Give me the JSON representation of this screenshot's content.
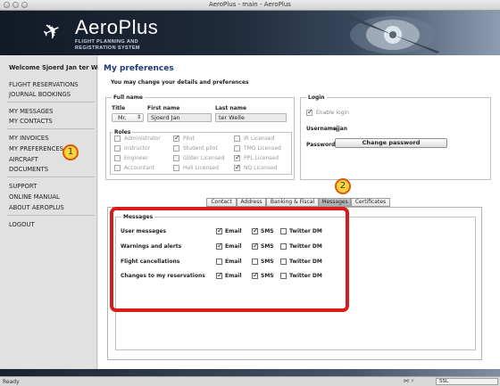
{
  "window": {
    "title": "AeroPlus - main - AeroPlus"
  },
  "brand": {
    "name": "AeroPlus",
    "tagline_1": "FLIGHT PLANNING AND",
    "tagline_2": "REGISTRATION SYSTEM"
  },
  "sidebar": {
    "welcome": "Welcome Sjoerd Jan ter Welle",
    "items": [
      {
        "label": "FLIGHT RESERVATIONS"
      },
      {
        "label": "JOURNAL BOOKINGS"
      },
      {
        "label": "MY MESSAGES"
      },
      {
        "label": "MY CONTACTS"
      },
      {
        "label": "MY INVOICES"
      },
      {
        "label": "MY PREFERENCES"
      },
      {
        "label": "AIRCRAFT"
      },
      {
        "label": "DOCUMENTS"
      },
      {
        "label": "SUPPORT"
      },
      {
        "label": "ONLINE MANUAL"
      },
      {
        "label": "ABOUT AEROPLUS"
      },
      {
        "label": "LOGOUT"
      }
    ]
  },
  "main": {
    "title": "My preferences",
    "subtitle": "You may change your details and preferences",
    "full_name": {
      "legend": "Full name",
      "title_label": "Title",
      "first_label": "First name",
      "last_label": "Last name",
      "title_value": "Mr.",
      "first_value": "Sjoerd Jan",
      "last_value": "ter Welle"
    },
    "roles": {
      "legend": "Roles",
      "items": [
        {
          "label": "Administrator",
          "checked": false
        },
        {
          "label": "Pilot",
          "checked": true
        },
        {
          "label": "IR Licensed",
          "checked": false
        },
        {
          "label": "Instructor",
          "checked": false
        },
        {
          "label": "Student pilot",
          "checked": false
        },
        {
          "label": "TMG Licensed",
          "checked": false
        },
        {
          "label": "Engineer",
          "checked": false
        },
        {
          "label": "Glider Licensed",
          "checked": false
        },
        {
          "label": "PPL Licensed",
          "checked": true
        },
        {
          "label": "Accountant",
          "checked": false
        },
        {
          "label": "Heli Licensed",
          "checked": false
        },
        {
          "label": "NQ Licensed",
          "checked": true
        }
      ]
    },
    "login": {
      "legend": "Login",
      "enable_label": "Enable login",
      "username_label": "Username",
      "username_value": "sjjan",
      "password_label": "Password",
      "change_password": "Change password"
    },
    "tabs": [
      {
        "label": "Contact",
        "active": false
      },
      {
        "label": "Address",
        "active": false
      },
      {
        "label": "Banking & Fiscal",
        "active": false
      },
      {
        "label": "Messages",
        "active": true
      },
      {
        "label": "Certificates",
        "active": false
      }
    ],
    "messages": {
      "legend": "Messages",
      "option_labels": [
        "Email",
        "SMS",
        "Twitter DM"
      ],
      "rows": [
        {
          "label": "User messages",
          "email": true,
          "sms": true,
          "twitter": false
        },
        {
          "label": "Warnings and alerts",
          "email": true,
          "sms": true,
          "twitter": false
        },
        {
          "label": "Flight cancellations",
          "email": false,
          "sms": false,
          "twitter": false
        },
        {
          "label": "Changes to my reservations",
          "email": true,
          "sms": true,
          "twitter": false
        }
      ]
    }
  },
  "annotations": {
    "callout_1": "1",
    "callout_2": "2",
    "highlight_color": "#d71c1c",
    "callout_color": "#fbd33a"
  },
  "status": {
    "text": "Ready",
    "ssl": "SSL"
  },
  "colors": {
    "title_blue": "#1d3a78"
  }
}
